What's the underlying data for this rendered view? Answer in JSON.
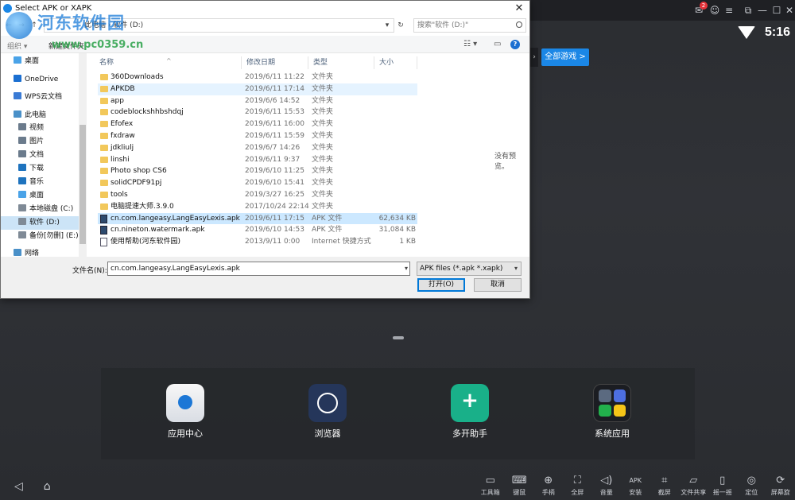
{
  "dialog": {
    "title": "Select APK or XAPK",
    "breadcrumb": "此电脑  ›  软件 (D:)",
    "search_placeholder": "搜索\"软件 (D:)\"",
    "toolbar": {
      "organize": "组织 ▾",
      "new_folder": "新建文件夹"
    },
    "nav": {
      "items": [
        {
          "label": "桌面",
          "color": "#4aa3e8"
        },
        {
          "label": "OneDrive",
          "color": "#1b6fd1"
        },
        {
          "label": "WPS云文档",
          "color": "#3a7bd5"
        },
        {
          "label": "此电脑",
          "color": "#4a90c8"
        },
        {
          "label": "视频",
          "color": "#6b7b8c"
        },
        {
          "label": "图片",
          "color": "#6b7b8c"
        },
        {
          "label": "文档",
          "color": "#6b7b8c"
        },
        {
          "label": "下载",
          "color": "#1e73be"
        },
        {
          "label": "音乐",
          "color": "#1e73be"
        },
        {
          "label": "桌面",
          "color": "#4aa3e8"
        },
        {
          "label": "本地磁盘 (C:)",
          "color": "#7f8a96"
        },
        {
          "label": "软件 (D:)",
          "color": "#7f8a96"
        },
        {
          "label": "备份[勿删] (E:)",
          "color": "#7f8a96"
        },
        {
          "label": "网络",
          "color": "#4a90c8"
        }
      ]
    },
    "columns": {
      "name": "名称",
      "date": "修改日期",
      "type": "类型",
      "size": "大小"
    },
    "files": [
      {
        "name": "360Downloads",
        "date": "2019/6/11 11:22",
        "type": "文件夹",
        "size": "",
        "kind": "folder"
      },
      {
        "name": "APKDB",
        "date": "2019/6/11 17:14",
        "type": "文件夹",
        "size": "",
        "kind": "folder"
      },
      {
        "name": "app",
        "date": "2019/6/6 14:52",
        "type": "文件夹",
        "size": "",
        "kind": "folder"
      },
      {
        "name": "codeblockshhbshdqj",
        "date": "2019/6/11 15:53",
        "type": "文件夹",
        "size": "",
        "kind": "folder"
      },
      {
        "name": "Efofex",
        "date": "2019/6/11 16:00",
        "type": "文件夹",
        "size": "",
        "kind": "folder"
      },
      {
        "name": "fxdraw",
        "date": "2019/6/11 15:59",
        "type": "文件夹",
        "size": "",
        "kind": "folder"
      },
      {
        "name": "jdkliulj",
        "date": "2019/6/7 14:26",
        "type": "文件夹",
        "size": "",
        "kind": "folder"
      },
      {
        "name": "linshi",
        "date": "2019/6/11 9:37",
        "type": "文件夹",
        "size": "",
        "kind": "folder"
      },
      {
        "name": "Photo shop CS6",
        "date": "2019/6/10 11:25",
        "type": "文件夹",
        "size": "",
        "kind": "folder"
      },
      {
        "name": "solidCPDF91pj",
        "date": "2019/6/10 15:41",
        "type": "文件夹",
        "size": "",
        "kind": "folder"
      },
      {
        "name": "tools",
        "date": "2019/3/27 16:25",
        "type": "文件夹",
        "size": "",
        "kind": "folder"
      },
      {
        "name": "电脑提速大师.3.9.0",
        "date": "2017/10/24 22:14",
        "type": "文件夹",
        "size": "",
        "kind": "folder"
      },
      {
        "name": "cn.com.langeasy.LangEasyLexis.apk",
        "date": "2019/6/11 17:15",
        "type": "APK 文件",
        "size": "62,634 KB",
        "kind": "apk"
      },
      {
        "name": "cn.nineton.watermark.apk",
        "date": "2019/6/10 14:53",
        "type": "APK 文件",
        "size": "31,084 KB",
        "kind": "apk"
      },
      {
        "name": "使用帮助(河东软件园)",
        "date": "2013/9/11 0:00",
        "type": "Internet 快捷方式",
        "size": "1 KB",
        "kind": "link"
      }
    ],
    "no_preview": "没有预览。",
    "filename_label": "文件名(N):",
    "filename_value": "cn.com.langeasy.LangEasyLexis.apk",
    "filter_value": "APK files (*.apk *.xapk)",
    "open_label": "打开(O)",
    "cancel_label": "取消"
  },
  "watermark": {
    "name": "河东软件园",
    "url": "www.pc0359.cn"
  },
  "emulator": {
    "clock": "5:16",
    "notification_count": "2",
    "all_games": "全部游戏 >",
    "dock": [
      {
        "label": "应用中心"
      },
      {
        "label": "浏览器"
      },
      {
        "label": "多开助手"
      },
      {
        "label": "系统应用"
      }
    ],
    "toolbar": [
      {
        "label": "工具箱",
        "icon": "▭"
      },
      {
        "label": "键鼠",
        "icon": "⌨"
      },
      {
        "label": "手柄",
        "icon": "⊕"
      },
      {
        "label": "全屏",
        "icon": "⛶"
      },
      {
        "label": "音量",
        "icon": "◁)"
      },
      {
        "label": "安装",
        "icon": "APK"
      },
      {
        "label": "截屏",
        "icon": "⌗"
      },
      {
        "label": "文件共享",
        "icon": "▱"
      },
      {
        "label": "摇一摇",
        "icon": "▯"
      },
      {
        "label": "定位",
        "icon": "◎"
      },
      {
        "label": "屏幕旋",
        "icon": "⟳"
      }
    ]
  }
}
